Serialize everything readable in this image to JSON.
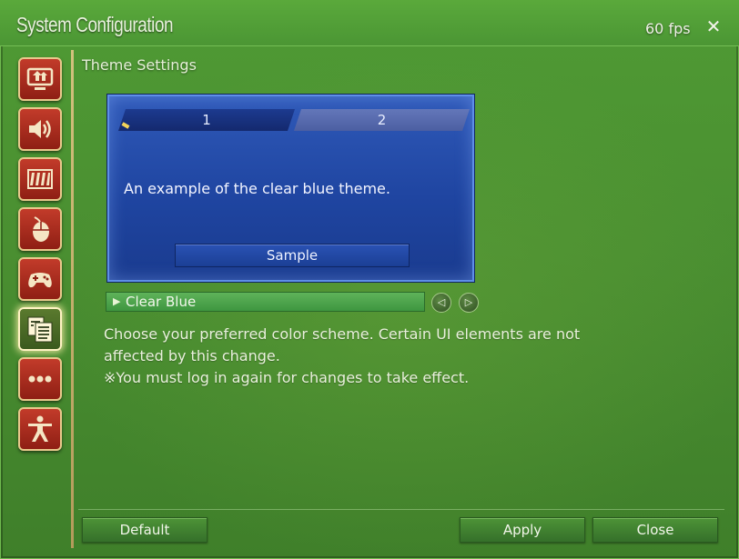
{
  "window": {
    "title": "System Configuration",
    "fps": "60 fps",
    "close_glyph": "✕"
  },
  "sidebar": {
    "items": [
      {
        "icon": "monitor-icon"
      },
      {
        "icon": "speaker-icon"
      },
      {
        "icon": "bars-icon"
      },
      {
        "icon": "mouse-icon"
      },
      {
        "icon": "gamepad-icon"
      },
      {
        "icon": "documents-icon",
        "active": true
      },
      {
        "icon": "more-icon"
      },
      {
        "icon": "figure-icon"
      }
    ]
  },
  "main": {
    "section_title": "Theme Settings",
    "preview": {
      "tab1": "1",
      "tab2": "2",
      "text": "An example of the clear blue theme.",
      "sample_button": "Sample"
    },
    "theme_select": {
      "arrow": "▶",
      "value": "Clear Blue",
      "prev_glyph": "◁",
      "next_glyph": "▷"
    },
    "description": {
      "line1": "Choose your preferred color scheme. Certain UI elements are not",
      "line2": "affected by this change.",
      "line3": "※You must log in again for changes to take effect."
    }
  },
  "footer": {
    "default_label": "Default",
    "apply_label": "Apply",
    "close_label": "Close"
  },
  "colors": {
    "window_green": "#4a8f31",
    "preview_blue": "#1f45a1",
    "dropdown_green": "#3e9640",
    "rail_red": "#a52a1c",
    "rail_border": "#e8c98c"
  }
}
